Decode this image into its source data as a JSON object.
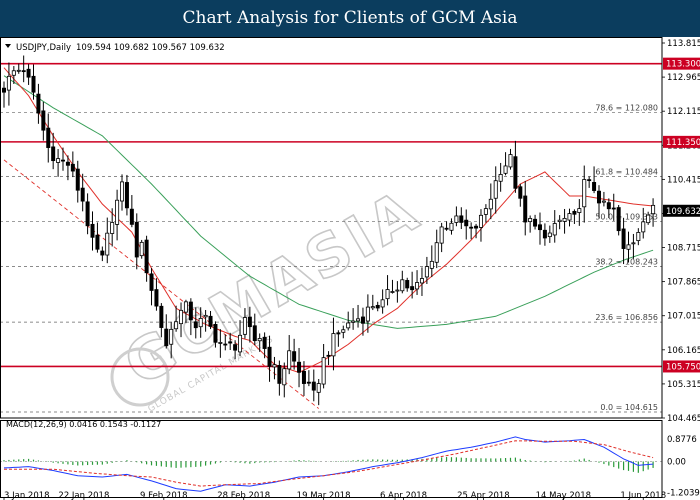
{
  "banner": {
    "title": "Chart Analysis for Clients of GCM Asia"
  },
  "header": {
    "symbol": "USDJPY,Daily",
    "ohlc": "109.594 109.682 109.567 109.632"
  },
  "macd": {
    "label": "MACD(12,26,9) 0.0416 0.1543 -0.1127"
  },
  "watermark": {
    "text": "GCMASIA",
    "sub": "GLOBAL CAPITAL MARKETS"
  },
  "colors": {
    "candle": "#000000",
    "ma_fast": "#e0302a",
    "ma_slow": "#3aa05a",
    "hline": "#cc0022",
    "trend": "#e0302a",
    "macd_line": "#1e3cff",
    "macd_signal": "#e0302a",
    "macd_hist": "#2a9a3a",
    "grid": "#666666"
  },
  "chart_data": [
    {
      "type": "candlestick",
      "symbol": "USDJPY",
      "timeframe": "Daily",
      "ylim": [
        104.465,
        113.815
      ],
      "y_ticks": [
        "113.815",
        "112.965",
        "112.115",
        "111.265",
        "110.415",
        "109.565",
        "108.715",
        "107.865",
        "107.015",
        "106.165",
        "105.315",
        "104.465"
      ],
      "x_labels": [
        "3 Jan 2018",
        "22 Jan 2018",
        "9 Feb 2018",
        "28 Feb 2018",
        "19 Mar 2018",
        "6 Apr 2018",
        "25 Apr 2018",
        "14 May 2018",
        "1 Jun 2018"
      ],
      "x_label_index": [
        0,
        13,
        26,
        39,
        52,
        65,
        78,
        91,
        104
      ],
      "n_bars": 106,
      "anchors": [
        [
          0,
          112.7
        ],
        [
          2,
          113.1
        ],
        [
          4,
          113.2
        ],
        [
          6,
          112.5
        ],
        [
          9,
          111.2
        ],
        [
          11,
          110.9
        ],
        [
          13,
          110.8
        ],
        [
          16,
          109.9
        ],
        [
          18,
          108.8
        ],
        [
          20,
          108.4
        ],
        [
          22,
          109.5
        ],
        [
          24,
          110.2
        ],
        [
          25,
          109.8
        ],
        [
          27,
          108.6
        ],
        [
          28,
          108.7
        ],
        [
          30,
          107.7
        ],
        [
          33,
          106.3
        ],
        [
          35,
          107.0
        ],
        [
          37,
          107.2
        ],
        [
          39,
          106.8
        ],
        [
          41,
          106.9
        ],
        [
          43,
          106.5
        ],
        [
          45,
          106.2
        ],
        [
          47,
          106.3
        ],
        [
          49,
          106.8
        ],
        [
          51,
          106.4
        ],
        [
          52,
          106.5
        ],
        [
          54,
          105.9
        ],
        [
          56,
          105.4
        ],
        [
          58,
          106.1
        ],
        [
          60,
          105.6
        ],
        [
          63,
          105.0
        ],
        [
          65,
          105.9
        ],
        [
          67,
          106.4
        ],
        [
          69,
          106.7
        ],
        [
          71,
          106.9
        ],
        [
          73,
          107.0
        ],
        [
          75,
          107.3
        ],
        [
          77,
          107.3
        ],
        [
          79,
          107.7
        ],
        [
          81,
          107.9
        ],
        [
          83,
          107.6
        ],
        [
          85,
          107.9
        ],
        [
          87,
          108.5
        ],
        [
          89,
          109.2
        ],
        [
          91,
          109.4
        ],
        [
          93,
          109.3
        ],
        [
          95,
          109.1
        ],
        [
          97,
          109.4
        ],
        [
          99,
          110.0
        ],
        [
          101,
          110.7
        ],
        [
          103,
          110.9
        ],
        [
          104,
          110.3
        ],
        [
          106,
          109.3
        ],
        [
          108,
          109.4
        ],
        [
          110,
          108.8
        ],
        [
          112,
          109.3
        ],
        [
          114,
          109.4
        ],
        [
          116,
          109.4
        ],
        [
          118,
          110.3
        ],
        [
          120,
          110.2
        ],
        [
          122,
          109.7
        ],
        [
          124,
          109.6
        ],
        [
          126,
          108.6
        ],
        [
          128,
          108.9
        ],
        [
          130,
          109.5
        ],
        [
          132,
          109.63
        ]
      ],
      "ma_fast_anchors": [
        [
          0,
          113.2
        ],
        [
          5,
          112.5
        ],
        [
          10,
          111.5
        ],
        [
          15,
          110.6
        ],
        [
          20,
          109.8
        ],
        [
          26,
          109.1
        ],
        [
          30,
          108.2
        ],
        [
          35,
          107.2
        ],
        [
          41,
          106.8
        ],
        [
          47,
          106.5
        ],
        [
          50,
          106.4
        ],
        [
          55,
          105.8
        ],
        [
          60,
          105.6
        ],
        [
          65,
          105.9
        ],
        [
          70,
          106.3
        ],
        [
          75,
          106.8
        ],
        [
          80,
          107.2
        ],
        [
          85,
          107.8
        ],
        [
          90,
          108.3
        ],
        [
          95,
          108.9
        ],
        [
          100,
          109.6
        ],
        [
          105,
          110.3
        ],
        [
          110,
          110.6
        ],
        [
          115,
          110.0
        ],
        [
          118,
          110.0
        ],
        [
          123,
          109.9
        ],
        [
          128,
          109.8
        ],
        [
          132,
          109.75
        ]
      ],
      "ma_slow_anchors": [
        [
          0,
          113.0
        ],
        [
          10,
          112.2
        ],
        [
          20,
          111.5
        ],
        [
          30,
          110.3
        ],
        [
          40,
          109.0
        ],
        [
          50,
          108.0
        ],
        [
          60,
          107.3
        ],
        [
          70,
          106.9
        ],
        [
          80,
          106.7
        ],
        [
          90,
          106.8
        ],
        [
          100,
          107.0
        ],
        [
          110,
          107.5
        ],
        [
          120,
          108.1
        ],
        [
          126,
          108.4
        ],
        [
          132,
          108.65
        ]
      ],
      "horizontal_levels": [
        {
          "value": 113.3,
          "label": "113.300",
          "kind": "resistance"
        },
        {
          "value": 111.35,
          "label": "111.350",
          "kind": "resistance"
        },
        {
          "value": 105.75,
          "label": "105.750",
          "kind": "support"
        }
      ],
      "fib_levels": [
        {
          "label": "78.6 = 112.080",
          "value": 112.08
        },
        {
          "label": "61.8 = 110.484",
          "value": 110.484
        },
        {
          "label": "50.0 = 109.363",
          "value": 109.363
        },
        {
          "label": "38.2 = 108.243",
          "value": 108.243
        },
        {
          "label": "23.6 = 106.856",
          "value": 106.856
        },
        {
          "label": "0.0 = 104.615",
          "value": 104.615
        }
      ],
      "current_price": "109.632",
      "trendline": {
        "from": [
          0,
          110.9
        ],
        "to": [
          64,
          104.7
        ]
      }
    },
    {
      "type": "line",
      "name": "MACD(12,26,9)",
      "ylim": [
        -1.45,
        1.1
      ],
      "y_ticks": [
        "0.8776",
        "0.00",
        "-1.2039"
      ],
      "macd_anchors": [
        [
          0,
          -0.25
        ],
        [
          5,
          -0.2
        ],
        [
          10,
          -0.35
        ],
        [
          15,
          -0.55
        ],
        [
          20,
          -0.6
        ],
        [
          25,
          -0.5
        ],
        [
          30,
          -0.75
        ],
        [
          35,
          -1.05
        ],
        [
          40,
          -1.15
        ],
        [
          45,
          -0.9
        ],
        [
          50,
          -0.95
        ],
        [
          55,
          -0.8
        ],
        [
          60,
          -0.6
        ],
        [
          65,
          -0.55
        ],
        [
          70,
          -0.4
        ],
        [
          75,
          -0.2
        ],
        [
          80,
          -0.05
        ],
        [
          85,
          0.15
        ],
        [
          90,
          0.4
        ],
        [
          95,
          0.55
        ],
        [
          100,
          0.75
        ],
        [
          104,
          0.95
        ],
        [
          106,
          0.85
        ],
        [
          110,
          0.75
        ],
        [
          115,
          0.8
        ],
        [
          118,
          0.85
        ],
        [
          122,
          0.55
        ],
        [
          126,
          0.1
        ],
        [
          129,
          -0.15
        ],
        [
          132,
          -0.1
        ]
      ],
      "signal_anchors": [
        [
          0,
          -0.3
        ],
        [
          10,
          -0.3
        ],
        [
          18,
          -0.45
        ],
        [
          25,
          -0.55
        ],
        [
          30,
          -0.6
        ],
        [
          35,
          -0.8
        ],
        [
          40,
          -0.95
        ],
        [
          45,
          -0.9
        ],
        [
          52,
          -0.85
        ],
        [
          58,
          -0.7
        ],
        [
          65,
          -0.55
        ],
        [
          72,
          -0.38
        ],
        [
          78,
          -0.18
        ],
        [
          85,
          0.05
        ],
        [
          92,
          0.3
        ],
        [
          98,
          0.55
        ],
        [
          104,
          0.8
        ],
        [
          110,
          0.78
        ],
        [
          116,
          0.78
        ],
        [
          122,
          0.65
        ],
        [
          127,
          0.38
        ],
        [
          132,
          0.15
        ]
      ]
    }
  ]
}
